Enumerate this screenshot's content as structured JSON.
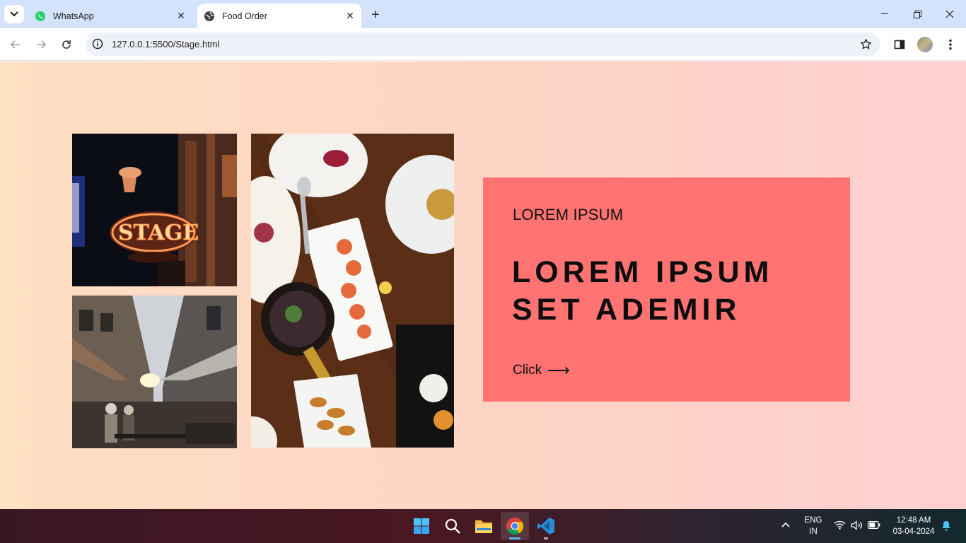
{
  "browser": {
    "tabs": [
      {
        "title": "WhatsApp",
        "icon": "whatsapp-icon",
        "active": false
      },
      {
        "title": "Food Order",
        "icon": "globe-icon",
        "active": true
      }
    ],
    "url": "127.0.0.1:5500/Stage.html"
  },
  "page": {
    "eyebrow": "LOREM IPSUM",
    "headline": "LOREM IPSUM SET ADEMIR",
    "cta_label": "Click",
    "cta_arrow": "⟶",
    "accent": "#ff7373",
    "images": [
      "neon-stage-sign-photo",
      "street-cafe-photo",
      "food-table-photo"
    ]
  },
  "taskbar": {
    "apps": [
      "windows-start-icon",
      "search-icon",
      "file-explorer-icon",
      "chrome-icon",
      "vscode-icon"
    ],
    "lang_line1": "ENG",
    "lang_line2": "IN",
    "time": "12:48 AM",
    "date": "03-04-2024"
  }
}
